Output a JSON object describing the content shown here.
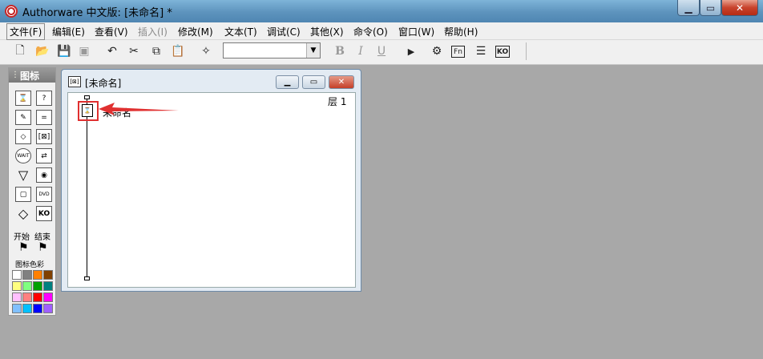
{
  "window": {
    "title": "Authorware 中文版: [未命名] *",
    "min": "▁",
    "max": "▭",
    "close": "✕"
  },
  "menu": [
    {
      "label": "文件(F)"
    },
    {
      "label": "编辑(E)"
    },
    {
      "label": "查看(V)"
    },
    {
      "label": "插入(I)",
      "disabled": true
    },
    {
      "label": "修改(M)"
    },
    {
      "label": "文本(T)"
    },
    {
      "label": "调试(C)"
    },
    {
      "label": "其他(X)"
    },
    {
      "label": "命令(O)"
    },
    {
      "label": "窗口(W)"
    },
    {
      "label": "帮助(H)"
    }
  ],
  "toolbar": {
    "new": "🗋",
    "open": "📂",
    "save": "💾",
    "import": "▣",
    "undo": "↶",
    "cut": "✂",
    "copy": "⧉",
    "paste": "📋",
    "find": "✧",
    "font_value": "",
    "font_arrow": "▼",
    "bold": "B",
    "italic": "I",
    "underline": "U",
    "run": "▶",
    "control": "⚙",
    "fn": "Fn",
    "list": "☰",
    "ko": "KO"
  },
  "palette": {
    "title": "图标",
    "start_label": "开始",
    "end_label": "结束",
    "color_label": "图标色彩",
    "icons": [
      {
        "glyph": "⌛"
      },
      {
        "glyph": "?"
      },
      {
        "glyph": "✎"
      },
      {
        "glyph": "="
      },
      {
        "glyph": "◇"
      },
      {
        "glyph": "[⊠]"
      },
      {
        "glyph": "WAIT"
      },
      {
        "glyph": "⇄"
      },
      {
        "glyph": "▽"
      },
      {
        "glyph": "◉"
      },
      {
        "glyph": "▢"
      },
      {
        "glyph": "DVD"
      },
      {
        "glyph": "◇"
      },
      {
        "glyph": "KO"
      }
    ],
    "flags": [
      "⚑",
      "⚑"
    ],
    "swatches": [
      "#ffffff",
      "#808080",
      "#ff8000",
      "#804000",
      "#ffff80",
      "#80ff80",
      "#00a000",
      "#008080",
      "#ffc0ff",
      "#ff8080",
      "#ff0000",
      "#ff00ff",
      "#80c0ff",
      "#00c0ff",
      "#0000ff",
      "#a060ff"
    ]
  },
  "flowchart": {
    "title": "[未命名]",
    "layer": "层 1",
    "item_label": "未命名",
    "min": "▁",
    "max": "▭",
    "close": "✕",
    "icon_glyph": "⌛"
  }
}
